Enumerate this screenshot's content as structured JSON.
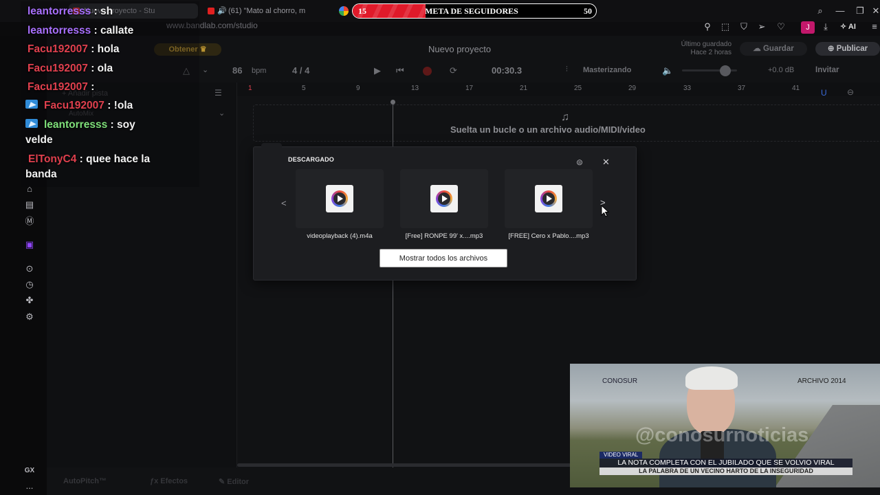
{
  "browser": {
    "tabs": [
      {
        "label": "Nuevo proyecto - Stu",
        "active": true
      },
      {
        "label": "(61) \"Mato al chorro, m",
        "active": false
      }
    ],
    "url": "www.bandlab.com/studio",
    "ai_label": "AI",
    "profile_initial": "J"
  },
  "goal": {
    "current": "15",
    "label": "META DE SEGUIDORES",
    "target": "50",
    "progress_fraction": 0.3,
    "fill_color": "#e01a2a"
  },
  "chat": [
    {
      "user": "leantorresss",
      "message": ": sh",
      "color": "#a970ff",
      "badge": false
    },
    {
      "user": "leantorresss",
      "message": ": callate",
      "color": "#a970ff",
      "badge": false
    },
    {
      "user": "Facu192007",
      "message": ": hola",
      "color": "#e0404e",
      "badge": false
    },
    {
      "user": "Facu192007",
      "message": ": ola",
      "color": "#e0404e",
      "badge": false
    },
    {
      "user": "Facu192007",
      "message": ":",
      "color": "#e0404e",
      "badge": false
    },
    {
      "user": "Facu192007",
      "message": ": !ola",
      "color": "#e0404e",
      "badge": true
    },
    {
      "user": "leantorresss",
      "message": ": soy",
      "message_cont": "velde",
      "color": "#7fe07a",
      "badge": true
    },
    {
      "user": "ElTonyC4",
      "message": ": quee hace la",
      "message_cont": "banda",
      "color": "#e0404e",
      "badge": false
    }
  ],
  "studio": {
    "get_label": "Obtener",
    "project_title": "Nuevo proyecto",
    "last_saved": "Último guardado",
    "last_saved_time": "Hace 2 horas",
    "save_label": "Guardar",
    "publish_label": "Publicar",
    "bpm_value": "86",
    "bpm_unit": "bpm",
    "time_signature": "4 / 4",
    "time": "00:30.3",
    "mastering_label": "Masterizando",
    "gain": "+0.0 dB",
    "invite_label": "Invitar",
    "add_track": "Añadir pista",
    "automix": "AutoMix",
    "ruler": [
      "1",
      "5",
      "9",
      "13",
      "17",
      "21",
      "25",
      "29",
      "33",
      "37",
      "41"
    ],
    "drop_hint": "Suelta un bucle o un archivo audio/MIDI/video",
    "bottom": [
      "AutoPitch™",
      "Efectos",
      "Editor"
    ]
  },
  "download": {
    "title": "DESCARGADO",
    "files": [
      {
        "name": "videoplayback (4).m4a"
      },
      {
        "name": "[Free] RONPE 99' x....mp3"
      },
      {
        "name": "[FREE] Cero x Pablo....mp3"
      }
    ],
    "show_all": "Mostrar todos los archivos",
    "prev": "<",
    "next": ">"
  },
  "news": {
    "logo": "CONOSUR",
    "archive": "ARCHIVO 2014",
    "watermark": "@conosurnoticias",
    "tag": "VIDEO VIRAL",
    "headline": "LA NOTA COMPLETA CON EL JUBILADO QUE SE VOLVIO VIRAL",
    "subheadline": "LA PALABRA DE UN VECINO HARTO DE LA INSEGURIDAD"
  },
  "sidebar": {
    "bottom_labels": [
      "GX",
      "..."
    ]
  }
}
